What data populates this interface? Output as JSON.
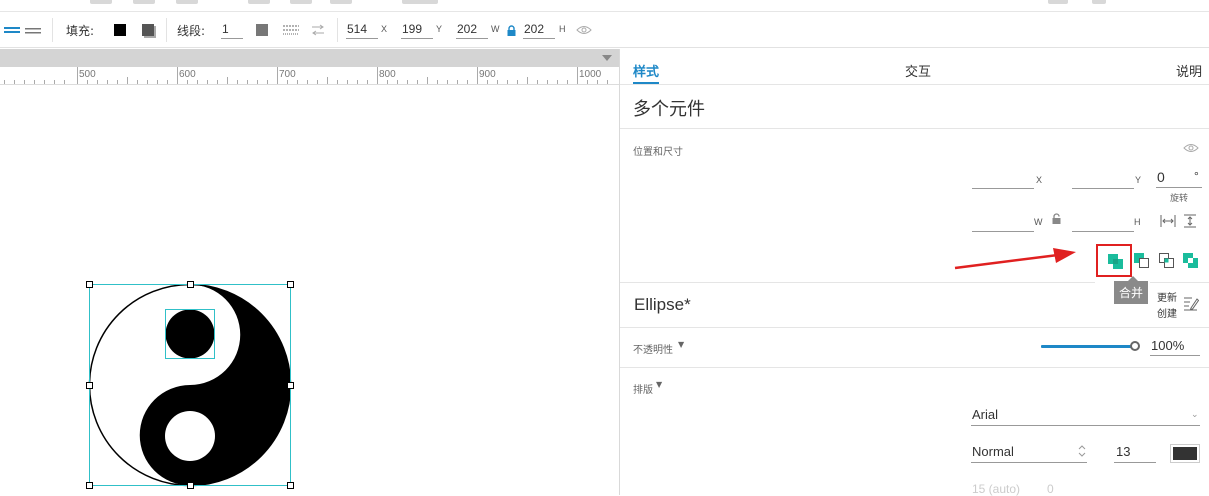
{
  "toolbar": {
    "fill_label": "填充:",
    "stroke_label": "线段:",
    "stroke_width": "1",
    "x_value": "514",
    "x_axis": "X",
    "y_value": "199",
    "y_axis": "Y",
    "w_value": "202",
    "w_axis": "W",
    "h_value": "202",
    "h_axis": "H"
  },
  "ruler": {
    "labels": [
      "500",
      "600",
      "700",
      "800",
      "900",
      "1000"
    ]
  },
  "panel": {
    "tabs": [
      "样式",
      "交互",
      "说明"
    ],
    "title": "多个元件",
    "position_section": "位置和尺寸",
    "x_axis": "X",
    "y_axis": "Y",
    "rotation_value": "0",
    "rotation_unit": "°",
    "rotation_label": "旋转",
    "w_axis": "W",
    "h_axis": "H",
    "tooltip": "合并",
    "component_name": "Ellipse*",
    "update_label": "更新",
    "create_label": "创建",
    "opacity_label": "不透明性",
    "opacity_value": "100%",
    "opacity_fraction": 1.0,
    "typography_label": "排版",
    "font_family": "Arial",
    "font_style": "Normal",
    "font_size": "13",
    "line_height": "15 (auto)",
    "letter_spacing": "0",
    "text_color": "#333333"
  },
  "colors": {
    "accent": "#1e88c7",
    "highlight": "#e02020",
    "teal": "#1abc9c"
  }
}
